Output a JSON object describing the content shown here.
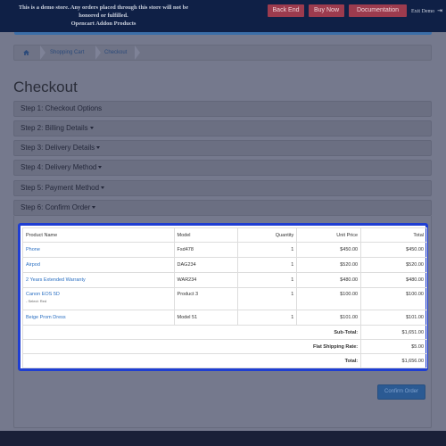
{
  "banner": {
    "text_lines": [
      "This is a demo store. Any orders placed through this store will not be",
      "honored or fulfilled.",
      "Opencart Addon Products"
    ],
    "buttons": [
      "Back End",
      "Buy Now",
      "Documentation"
    ],
    "exit_label": "Exit Demo"
  },
  "breadcrumb": [
    "Shopping Cart",
    "Checkout"
  ],
  "page_title": "Checkout",
  "steps": [
    "Step 1: Checkout Options",
    "Step 2: Billing Details",
    "Step 3: Delivery Details",
    "Step 4: Delivery Method",
    "Step 5: Payment Method",
    "Step 6: Confirm Order"
  ],
  "table": {
    "headers": [
      "Product Name",
      "Model",
      "Quantity",
      "Unit Price",
      "Total"
    ],
    "rows": [
      {
        "name": "Phone",
        "option": "",
        "model": "Fsd478",
        "qty": "1",
        "price": "$450.00",
        "total": "$450.00"
      },
      {
        "name": "Airpod",
        "option": "",
        "model": "DAG234",
        "qty": "1",
        "price": "$520.00",
        "total": "$520.00"
      },
      {
        "name": "2 Years Extended Warranty",
        "option": "",
        "model": "WAR234",
        "qty": "1",
        "price": "$480.00",
        "total": "$480.00"
      },
      {
        "name": "Canon EOS 5D",
        "option": "- Select: Red",
        "model": "Product 3",
        "qty": "1",
        "price": "$100.00",
        "total": "$100.00"
      },
      {
        "name": "Beige Prom Dress",
        "option": "",
        "model": "Model 51",
        "qty": "1",
        "price": "$101.00",
        "total": "$101.00"
      }
    ],
    "totals": [
      {
        "label": "Sub-Total:",
        "value": "$1,651.00"
      },
      {
        "label": "Flat Shipping Rate:",
        "value": "$5.00"
      },
      {
        "label": "Total:",
        "value": "$1,656.00"
      }
    ]
  },
  "confirm_label": "Confirm Order",
  "colors": {
    "highlight": "#1f3ed2",
    "link": "#2a6fc2",
    "banner_button": "#9c3b4e",
    "banner_bg": "#0f2046"
  }
}
